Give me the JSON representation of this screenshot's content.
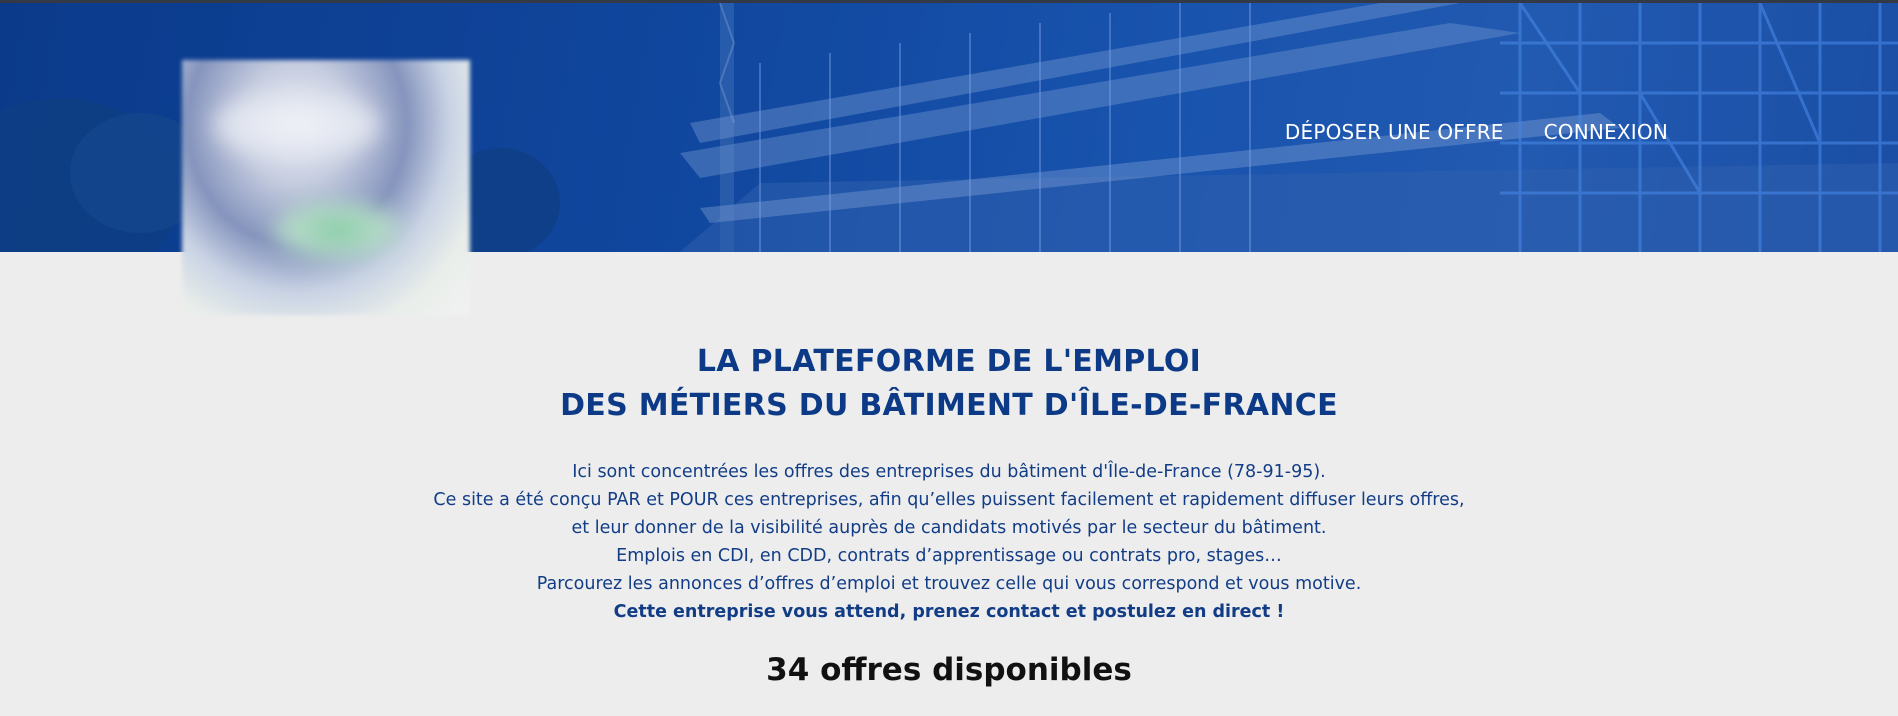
{
  "nav": {
    "deposit_label": "DÉPOSER UNE OFFRE",
    "login_label": "CONNEXION"
  },
  "heading": {
    "line1": "LA PLATEFORME DE L'EMPLOI",
    "line2": "DES MÉTIERS DU BÂTIMENT D'ÎLE-DE-FRANCE"
  },
  "intro": {
    "lines": [
      "Ici sont concentrées les offres des entreprises du bâtiment d'Île-de-France (78-91-95).",
      "Ce site a été conçu PAR et POUR ces entreprises, afin qu’elles puissent facilement et rapidement diffuser leurs offres,",
      "et leur donner de la visibilité auprès de candidats motivés par le secteur du bâtiment.",
      "Emplois en CDI, en CDD, contrats d’apprentissage ou contrats pro, stages…",
      "Parcourez les annonces d’offres d’emploi et trouvez celle qui vous correspond et vous motive."
    ],
    "cta": "Cette entreprise vous attend, prenez contact et postulez en direct !"
  },
  "offers": {
    "count_label": "34 offres disponibles"
  },
  "colors": {
    "brand_blue": "#0c3a86",
    "background": "#ededed",
    "hero_blue": "#124a9e"
  }
}
